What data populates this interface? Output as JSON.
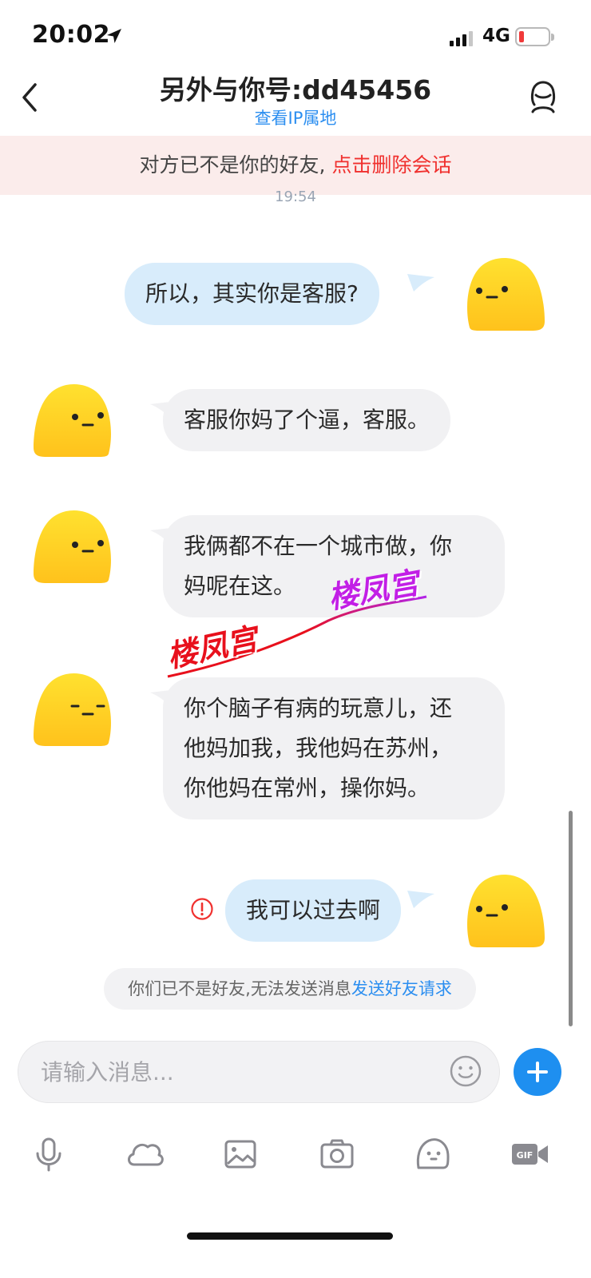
{
  "status_bar": {
    "time": "20:02",
    "network": "4G"
  },
  "header": {
    "title": "另外与你号:dd45456",
    "subtitle": "查看IP属地"
  },
  "banner": {
    "text": "对方已不是你的好友, ",
    "action": "点击删除会话"
  },
  "timestamp": "19:54",
  "messages": [
    {
      "side": "me",
      "lines": [
        "所以，其实你是客服?"
      ]
    },
    {
      "side": "them",
      "lines": [
        "客服你妈了个逼，客服。"
      ]
    },
    {
      "side": "them",
      "lines": [
        "我俩都不在一个城市做，你",
        "妈呢在这。"
      ]
    },
    {
      "side": "them",
      "lines": [
        "你个脑子有病的玩意儿，还",
        "他妈加我，我他妈在苏州，",
        "你他妈在常州，操你妈。"
      ]
    },
    {
      "side": "me",
      "lines": [
        "我可以过去啊"
      ],
      "failed": true
    }
  ],
  "watermarks": [
    "楼凤宫",
    "楼凤宫"
  ],
  "notice": {
    "text": "你们已不是好友,无法发送消息",
    "link": "发送好友请求"
  },
  "input": {
    "placeholder": "请输入消息..."
  },
  "toolbar": [
    "microphone-icon",
    "cloud-icon",
    "image-icon",
    "camera-icon",
    "sticker-icon",
    "gif-icon"
  ],
  "colors": {
    "accent": "#1e8ff0",
    "banner_bg": "#fbeceb",
    "warning_red": "#f0302e",
    "my_bubble": "#d8ecfb",
    "their_bubble": "#f1f1f3"
  }
}
